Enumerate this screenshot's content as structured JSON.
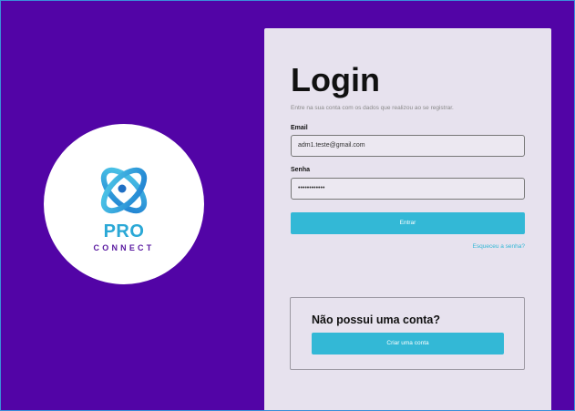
{
  "brand": {
    "name_top": "PRO",
    "name_bottom": "CONNECT",
    "logo_icon": "atom-orbit-icon",
    "colors": {
      "background": "#5204a6",
      "accent": "#33b8d6",
      "panel": "#e7e2ee"
    }
  },
  "login": {
    "title": "Login",
    "subtitle": "Entre na sua conta com os dados que realizou ao se registrar.",
    "email_label": "Email",
    "email_value": "adm1.teste@gmail.com",
    "password_label": "Senha",
    "password_value": "••••••••••••",
    "submit_label": "Entrar",
    "forgot_label": "Esqueceu a senha?"
  },
  "signup": {
    "title": "Não possui uma conta?",
    "button_label": "Criar uma conta"
  }
}
